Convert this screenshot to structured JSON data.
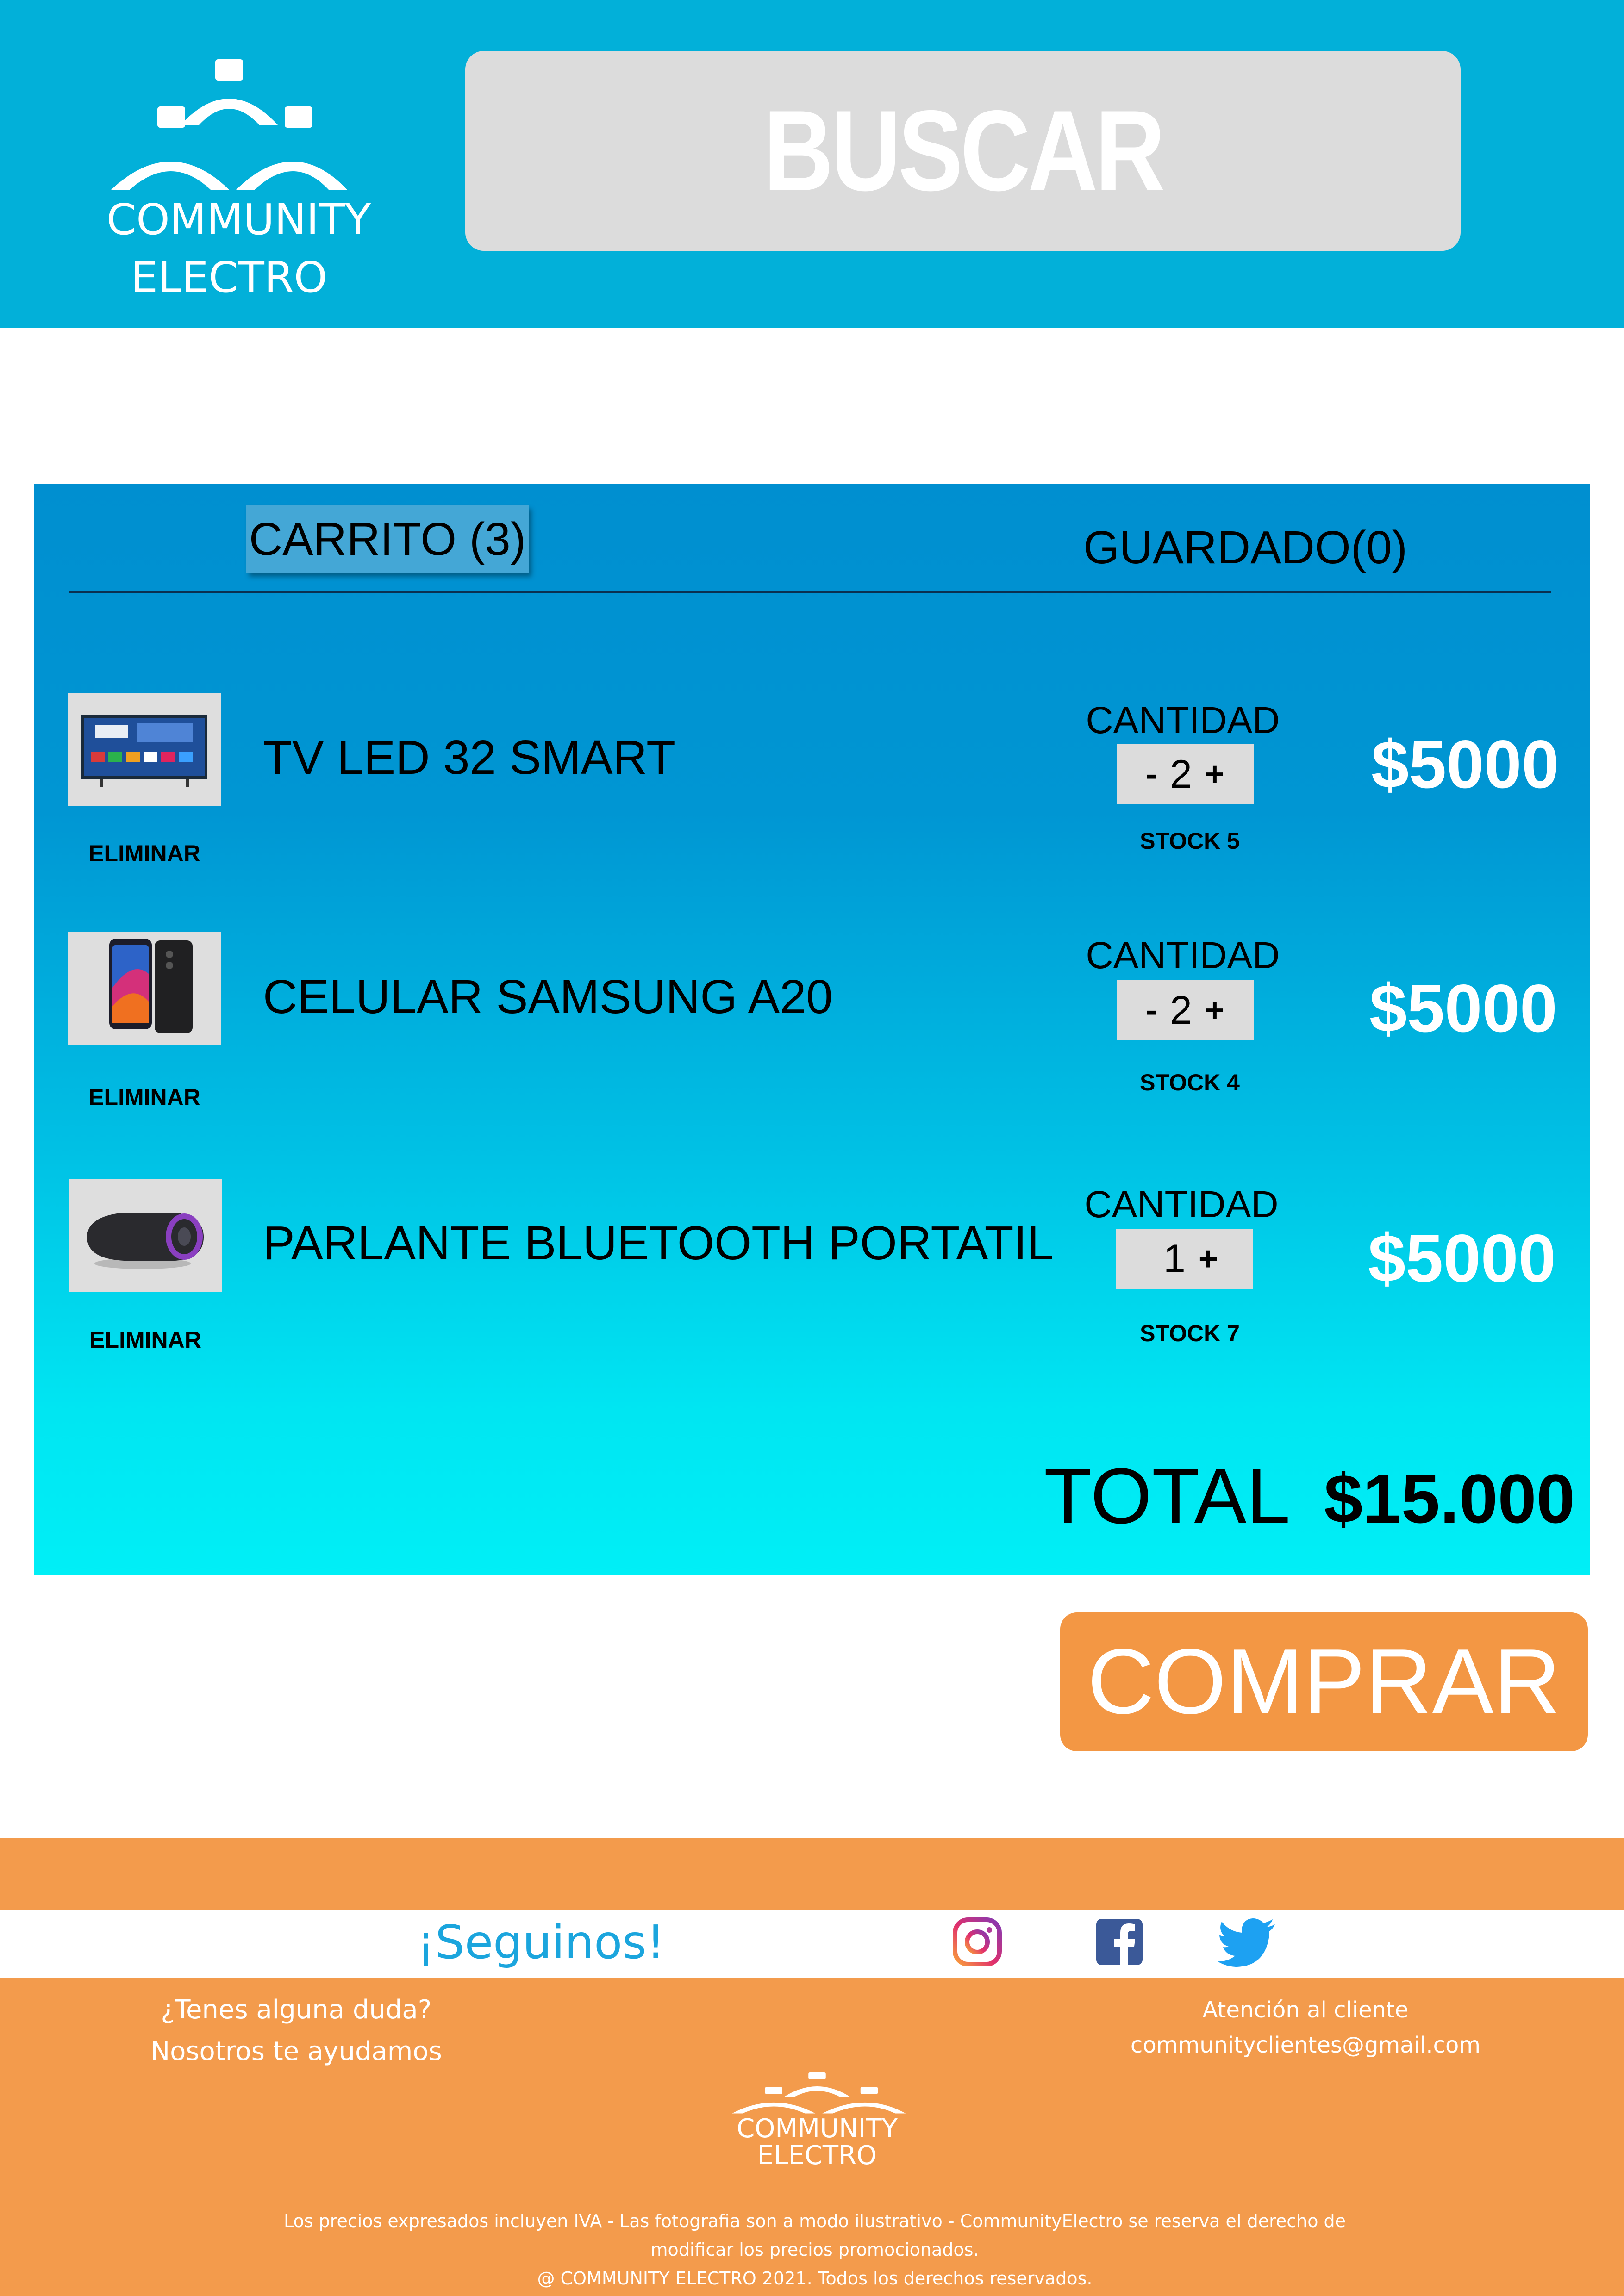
{
  "header": {
    "logo_line1": "COMMUNITY",
    "logo_line2": "ELECTRO",
    "search_label": "BUSCAR"
  },
  "cart": {
    "tab_cart": "CARRITO (3)",
    "tab_saved": "GUARDADO(0)",
    "items": [
      {
        "name": "TV LED 32 SMART",
        "remove": "ELIMINAR",
        "qty_label": "CANTIDAD",
        "minus": "-",
        "qty": "2",
        "plus": "+",
        "stock": "STOCK  5",
        "price": "$5000",
        "image": "tv-image"
      },
      {
        "name": "CELULAR SAMSUNG A20",
        "remove": "ELIMINAR",
        "qty_label": "CANTIDAD",
        "minus": "-",
        "qty": "2",
        "plus": "+",
        "stock": "STOCK  4",
        "price": "$5000",
        "image": "phone-image"
      },
      {
        "name": "PARLANTE BLUETOOTH PORTATIL",
        "remove": "ELIMINAR",
        "qty_label": "CANTIDAD",
        "minus": "",
        "qty": "1",
        "plus": "+",
        "stock": "STOCK  7",
        "price": "$5000",
        "image": "speaker-image"
      }
    ],
    "total_label": "TOTAL",
    "total_value": "$15.000"
  },
  "buy_label": "COMPRAR",
  "footer": {
    "follow": "¡Seguinos!",
    "social_icons": [
      "instagram-icon",
      "facebook-icon",
      "twitter-icon"
    ],
    "doubt_line1": "¿Tenes alguna duda?",
    "doubt_line2": "Nosotros te ayudamos",
    "support_title": "Atención al cliente",
    "support_email": "communityclientes@gmail.com",
    "logo_line1": "COMMUNITY",
    "logo_line2": "ELECTRO",
    "legal_line1": "Los precios expresados incluyen IVA - Las fotografia son a modo ilustrativo - CommunityElectro se reserva el derecho de",
    "legal_line2": "modificar los precios promocionados.",
    "legal_line3": "@ COMMUNITY ELECTRO 2021. Todos los derechos reservados."
  },
  "colors": {
    "header_bg": "#02b0d9",
    "footer_bg": "#f39b4c",
    "buy_button": "#f39744",
    "follow_text": "#1ba5dd"
  }
}
